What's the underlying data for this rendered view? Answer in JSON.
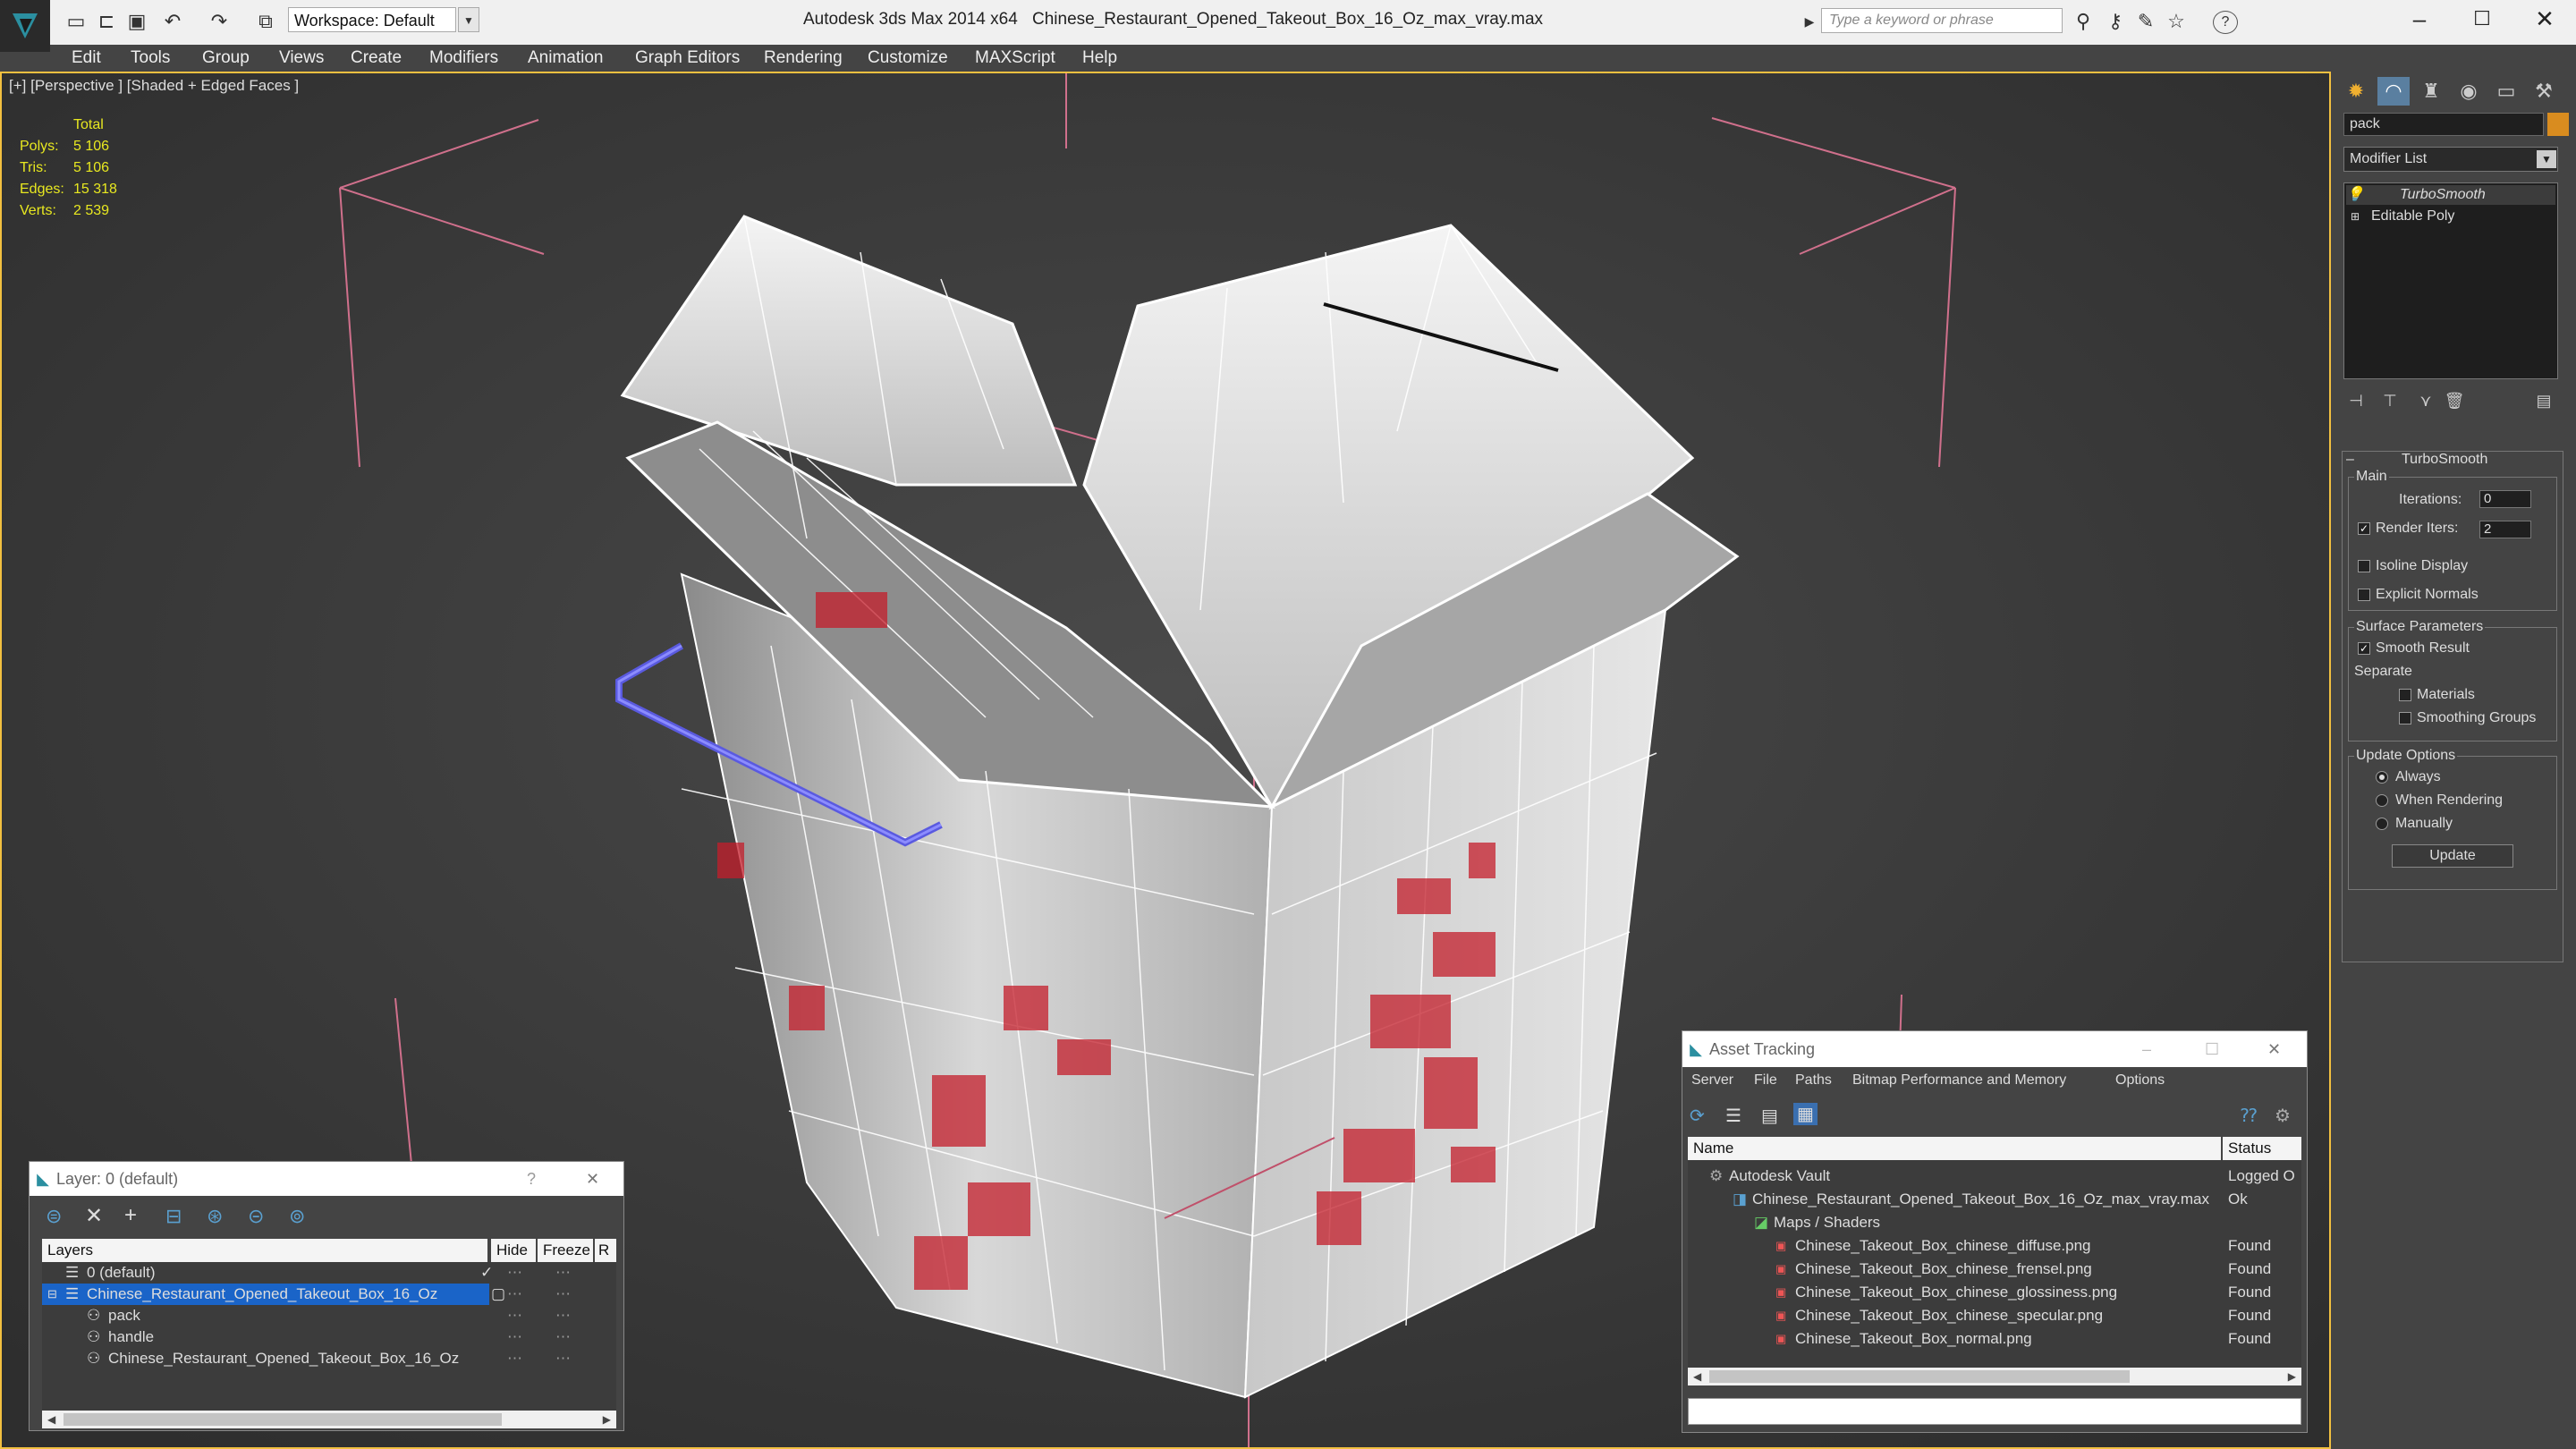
{
  "titlebar": {
    "app_title": "Autodesk 3ds Max  2014 x64",
    "file_title": "Chinese_Restaurant_Opened_Takeout_Box_16_Oz_max_vray.max",
    "workspace_label": "Workspace: Default",
    "search_placeholder": "Type a keyword or phrase"
  },
  "menu": [
    "Edit",
    "Tools",
    "Group",
    "Views",
    "Create",
    "Modifiers",
    "Animation",
    "Graph Editors",
    "Rendering",
    "Customize",
    "MAXScript",
    "Help"
  ],
  "viewport": {
    "label": "[+] [Perspective ] [Shaded + Edged Faces ]",
    "stats": {
      "header": "Total",
      "rows": [
        {
          "k": "Polys:",
          "v": "5 106"
        },
        {
          "k": "Tris:",
          "v": "5 106"
        },
        {
          "k": "Edges:",
          "v": "15 318"
        },
        {
          "k": "Verts:",
          "v": "2 539"
        }
      ]
    }
  },
  "command_panel": {
    "object_name": "pack",
    "object_color": "#d98c1f",
    "modifier_list": "Modifier List",
    "stack": [
      "TurboSmooth",
      "Editable Poly"
    ],
    "turbosmooth": {
      "title": "TurboSmooth",
      "main_label": "Main",
      "iterations_label": "Iterations:",
      "iterations_value": "0",
      "render_iters_label": "Render Iters:",
      "render_iters_value": "2",
      "render_iters_checked": true,
      "isoline_label": "Isoline Display",
      "explicit_normals_label": "Explicit Normals",
      "surface_params_label": "Surface Parameters",
      "smooth_result_label": "Smooth Result",
      "separate_label": "Separate",
      "materials_label": "Materials",
      "smoothing_groups_label": "Smoothing Groups",
      "update_options_label": "Update Options",
      "always_label": "Always",
      "when_rendering_label": "When Rendering",
      "manually_label": "Manually",
      "update_button": "Update"
    }
  },
  "layer_dialog": {
    "title": "Layer: 0 (default)",
    "help": "?",
    "columns": [
      "Layers",
      "Hide",
      "Freeze",
      "R"
    ],
    "rows": [
      {
        "name": "0 (default)",
        "indent": 0
      },
      {
        "name": "Chinese_Restaurant_Opened_Takeout_Box_16_Oz",
        "indent": 0
      },
      {
        "name": "pack",
        "indent": 1
      },
      {
        "name": "handle",
        "indent": 1
      },
      {
        "name": "Chinese_Restaurant_Opened_Takeout_Box_16_Oz",
        "indent": 1
      }
    ]
  },
  "asset_dialog": {
    "title": "Asset Tracking",
    "menu": [
      "Server",
      "File",
      "Paths",
      "Bitmap Performance and Memory",
      "Options"
    ],
    "columns": [
      "Name",
      "Status"
    ],
    "rows": [
      {
        "name": "Autodesk Vault",
        "status": "Logged O",
        "indent": 0
      },
      {
        "name": "Chinese_Restaurant_Opened_Takeout_Box_16_Oz_max_vray.max",
        "status": "Ok",
        "indent": 1
      },
      {
        "name": "Maps / Shaders",
        "status": "",
        "indent": 2
      },
      {
        "name": "Chinese_Takeout_Box_chinese_diffuse.png",
        "status": "Found",
        "indent": 3
      },
      {
        "name": "Chinese_Takeout_Box_chinese_frensel.png",
        "status": "Found",
        "indent": 3
      },
      {
        "name": "Chinese_Takeout_Box_chinese_glossiness.png",
        "status": "Found",
        "indent": 3
      },
      {
        "name": "Chinese_Takeout_Box_chinese_specular.png",
        "status": "Found",
        "indent": 3
      },
      {
        "name": "Chinese_Takeout_Box_normal.png",
        "status": "Found",
        "indent": 3
      }
    ]
  }
}
